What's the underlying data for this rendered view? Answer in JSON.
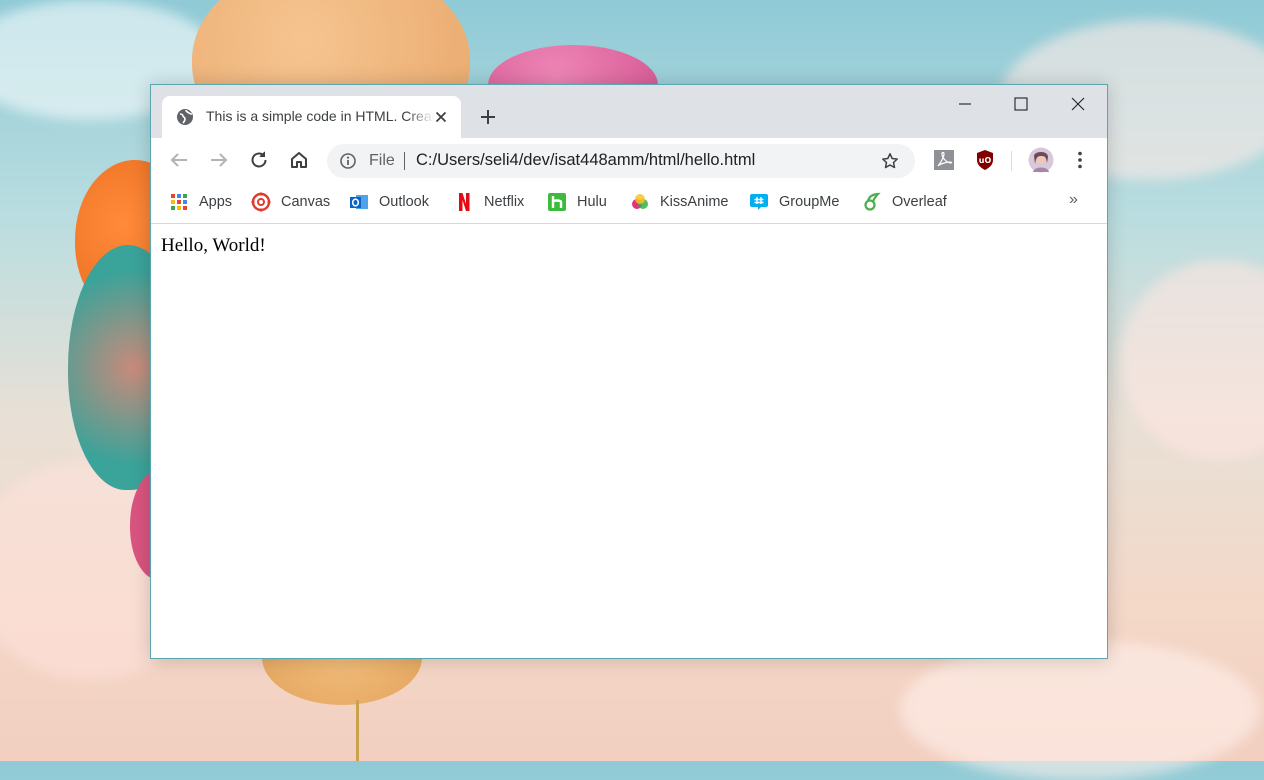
{
  "tab": {
    "title": "This is a simple code in HTML. Create",
    "icon": "globe-icon"
  },
  "window_controls": [
    "minimize-icon",
    "maximize-icon",
    "close-icon"
  ],
  "omnibox": {
    "scheme": "File",
    "url": "C:/Users/seli4/dev/isat448amm/html/hello.html"
  },
  "bookmarks": [
    {
      "label": "Apps",
      "icon": "apps-grid-icon"
    },
    {
      "label": "Canvas",
      "icon": "canvas-icon"
    },
    {
      "label": "Outlook",
      "icon": "outlook-icon"
    },
    {
      "label": "Netflix",
      "icon": "netflix-icon"
    },
    {
      "label": "Hulu",
      "icon": "hulu-icon"
    },
    {
      "label": "KissAnime",
      "icon": "kissanime-icon"
    },
    {
      "label": "GroupMe",
      "icon": "groupme-icon"
    },
    {
      "label": "Overleaf",
      "icon": "overleaf-icon"
    }
  ],
  "bookmarks_overflow": "»",
  "page": {
    "body_text": "Hello, World!"
  },
  "colors": {
    "titlebar": "#dee1e6",
    "omnibox": "#f1f3f4",
    "window_border": "#5aa7b0"
  }
}
